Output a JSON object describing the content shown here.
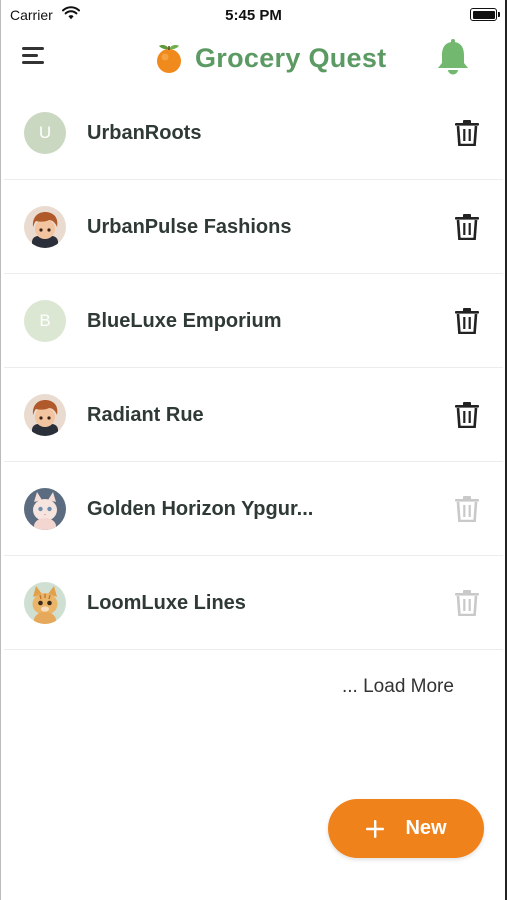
{
  "status_bar": {
    "carrier": "Carrier",
    "time": "5:45 PM",
    "wifi_icon": "wifi-icon",
    "battery_icon": "battery-icon"
  },
  "header": {
    "menu_icon": "menu-icon",
    "logo_icon": "orange-fruit-logo-icon",
    "title": "Grocery Quest",
    "title_color": "#5c9a63",
    "bell_icon": "bell-icon",
    "bell_color": "#72b86f"
  },
  "stores": [
    {
      "name": "UrbanRoots",
      "avatar_type": "initial",
      "avatar_text": "U",
      "delete_enabled": true
    },
    {
      "name": "UrbanPulse Fashions",
      "avatar_type": "image",
      "avatar_icon": "boy-cartoon-avatar-icon",
      "delete_enabled": true
    },
    {
      "name": "BlueLuxe Emporium",
      "avatar_type": "initial",
      "avatar_text": "B",
      "delete_enabled": true
    },
    {
      "name": "Radiant Rue",
      "avatar_type": "image",
      "avatar_icon": "boy-cartoon-avatar-icon",
      "delete_enabled": true
    },
    {
      "name": "Golden Horizon Ypgur...",
      "avatar_type": "image",
      "avatar_icon": "kitten-avatar-icon",
      "delete_enabled": false
    },
    {
      "name": "LoomLuxe Lines",
      "avatar_type": "image",
      "avatar_icon": "tabby-cat-avatar-icon",
      "delete_enabled": false
    }
  ],
  "load_more": "... Load More",
  "fab": {
    "label": "New",
    "icon": "plus-icon",
    "color": "#f0821c"
  }
}
